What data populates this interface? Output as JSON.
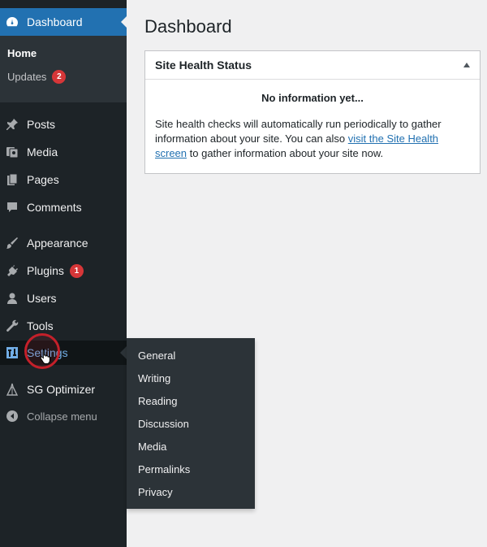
{
  "sidebar": {
    "dashboard_label": "Dashboard",
    "submenu": {
      "home_label": "Home",
      "updates_label": "Updates",
      "updates_count": "2"
    },
    "items": [
      {
        "label": "Posts",
        "icon": "pin-icon"
      },
      {
        "label": "Media",
        "icon": "media-icon"
      },
      {
        "label": "Pages",
        "icon": "pages-icon"
      },
      {
        "label": "Comments",
        "icon": "comments-icon"
      },
      {
        "label": "Appearance",
        "icon": "appearance-icon"
      },
      {
        "label": "Plugins",
        "icon": "plugins-icon",
        "badge": "1"
      },
      {
        "label": "Users",
        "icon": "users-icon"
      },
      {
        "label": "Tools",
        "icon": "tools-icon"
      },
      {
        "label": "Settings",
        "icon": "settings-icon"
      },
      {
        "label": "SG Optimizer",
        "icon": "sg-optimizer-icon"
      }
    ],
    "collapse_label": "Collapse menu",
    "settings_flyout": [
      "General",
      "Writing",
      "Reading",
      "Discussion",
      "Media",
      "Permalinks",
      "Privacy"
    ]
  },
  "main": {
    "title": "Dashboard",
    "panel": {
      "heading": "Site Health Status",
      "no_info": "No information yet...",
      "text_before": "Site health checks will automatically run periodically to gather information about your site. You can also ",
      "link_text": "visit the Site Health screen",
      "text_after": " to gather information about your site now."
    }
  },
  "colors": {
    "sidebar_bg": "#1d2327",
    "accent": "#2271b1",
    "badge": "#d63638",
    "settings_active": "#72aee6",
    "click_ring": "#c4202a"
  }
}
